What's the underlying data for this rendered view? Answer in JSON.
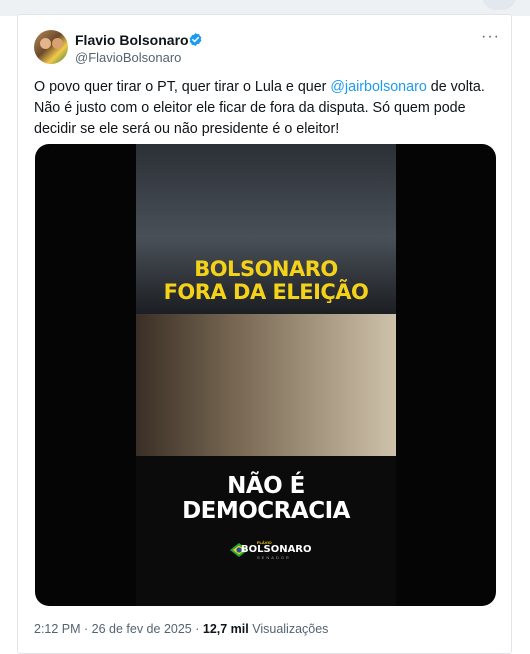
{
  "tweet": {
    "author_name": "Flavio Bolsonaro",
    "author_handle": "@FlavioBolsonaro",
    "more_label": "···",
    "text_before": "O povo quer tirar o PT, quer tirar o Lula e quer ",
    "mention": "@jairbolsonaro",
    "text_after": " de volta. Não é justo com o eleitor ele ficar de fora da disputa. Só quem pode decidir se ele será ou não presidente é o eleitor!",
    "media": {
      "headline_top_line1": "BOLSONARO",
      "headline_top_line2": "FORA DA ELEIÇÃO",
      "headline_bottom_line1": "NÃO É",
      "headline_bottom_line2": "DEMOCRACIA",
      "logo_small": "FLÁVIO",
      "logo_main": "BOLSONARO",
      "logo_sub": "SENADOR"
    },
    "timestamp": "2:12 PM · 26 de fev de 2025 ·",
    "views_count": "12,7 mil",
    "views_label": "Visualizações"
  },
  "colors": {
    "mention": "#1d9bf0",
    "verified": "#1d9bf0",
    "headline_yellow": "#f5d21a",
    "muted_text": "#536471"
  },
  "icons": {
    "verified": "verified-badge-icon",
    "more": "more-options-icon"
  }
}
